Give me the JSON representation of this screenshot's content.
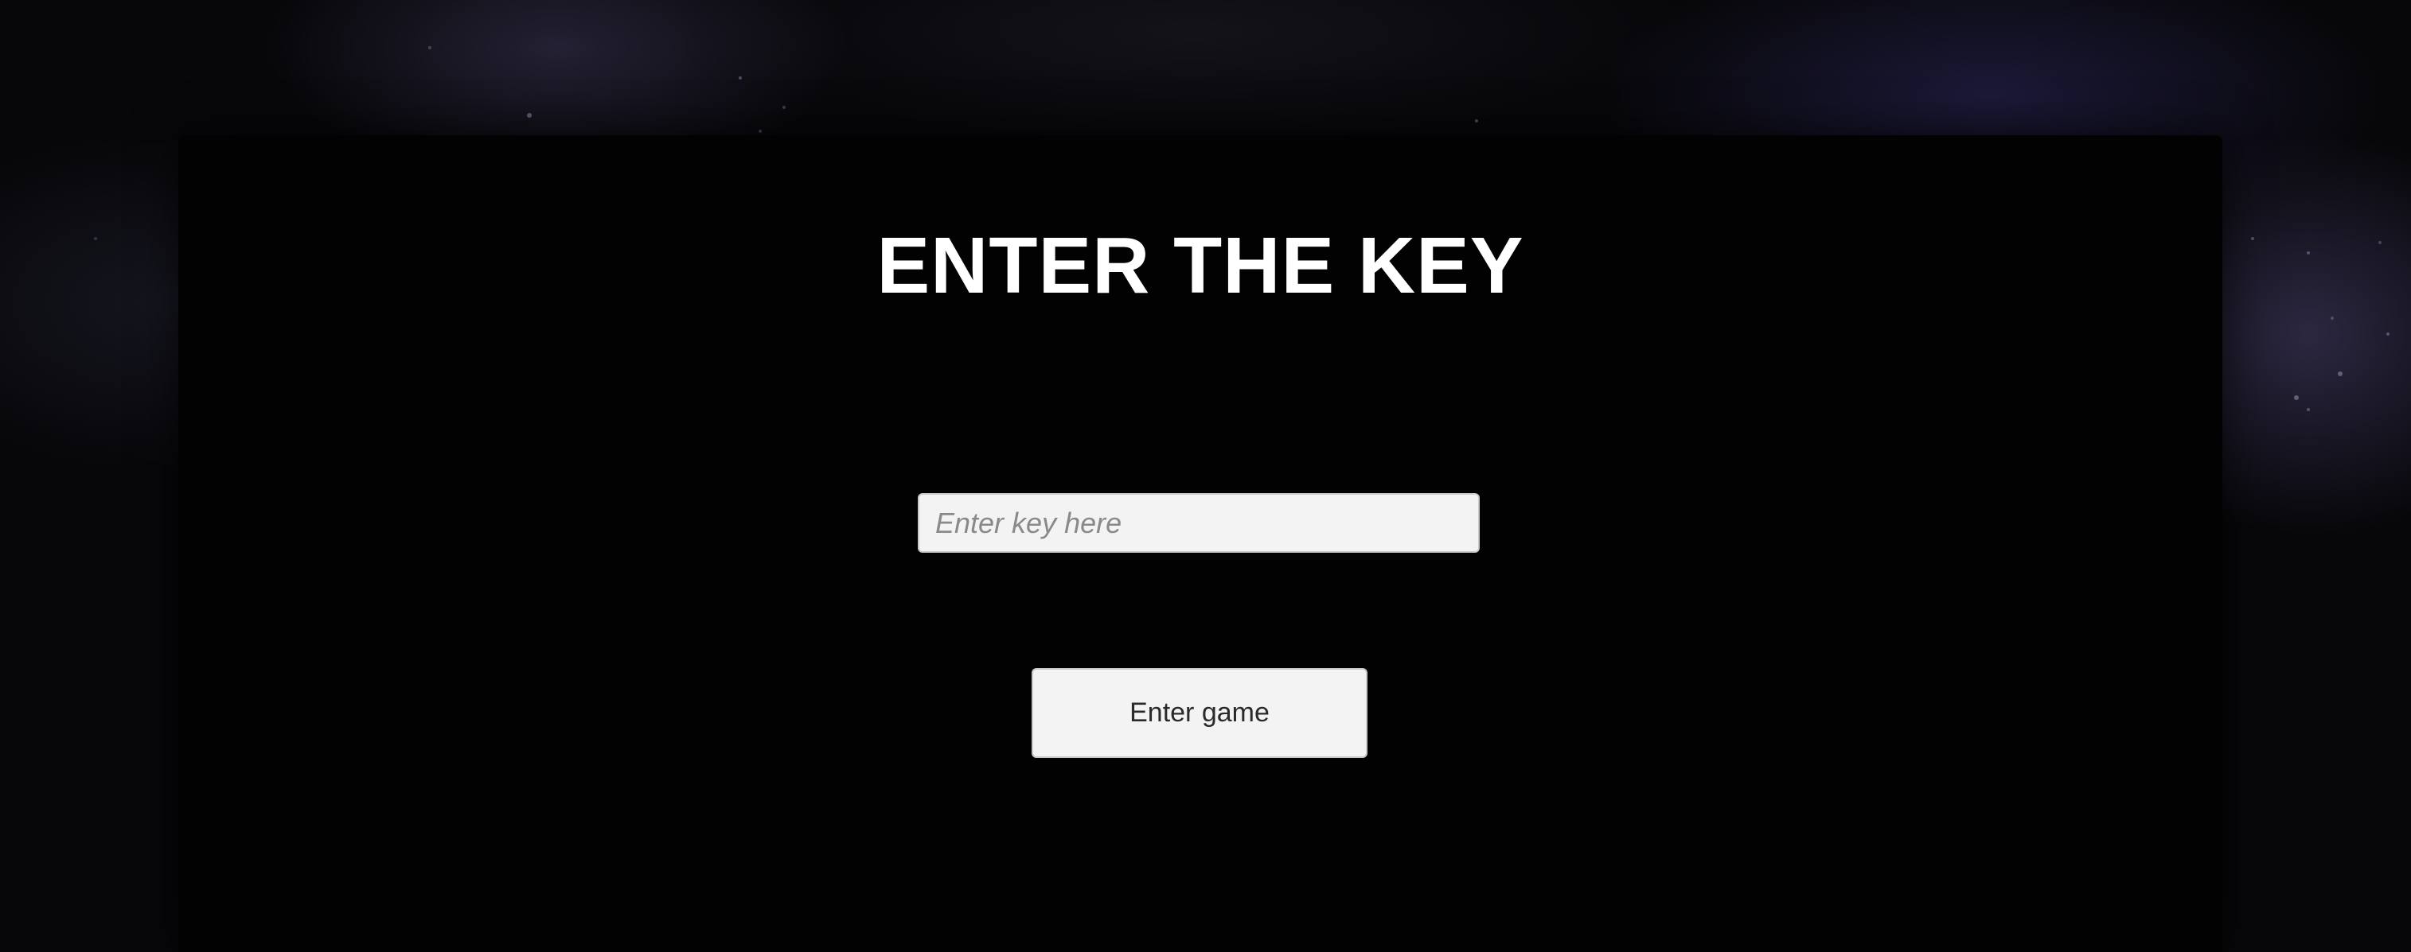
{
  "screen": {
    "title": "ENTER THE KEY",
    "key_input": {
      "value": "",
      "placeholder": "Enter key here"
    },
    "enter_button": {
      "label": "Enter game"
    }
  },
  "colors": {
    "panel_background": "#020202",
    "title_text": "#ffffff",
    "control_background": "#f3f3f3",
    "control_border": "#c9c9c9",
    "placeholder_text": "#8a8a8a",
    "button_text": "#2a2a2a"
  }
}
